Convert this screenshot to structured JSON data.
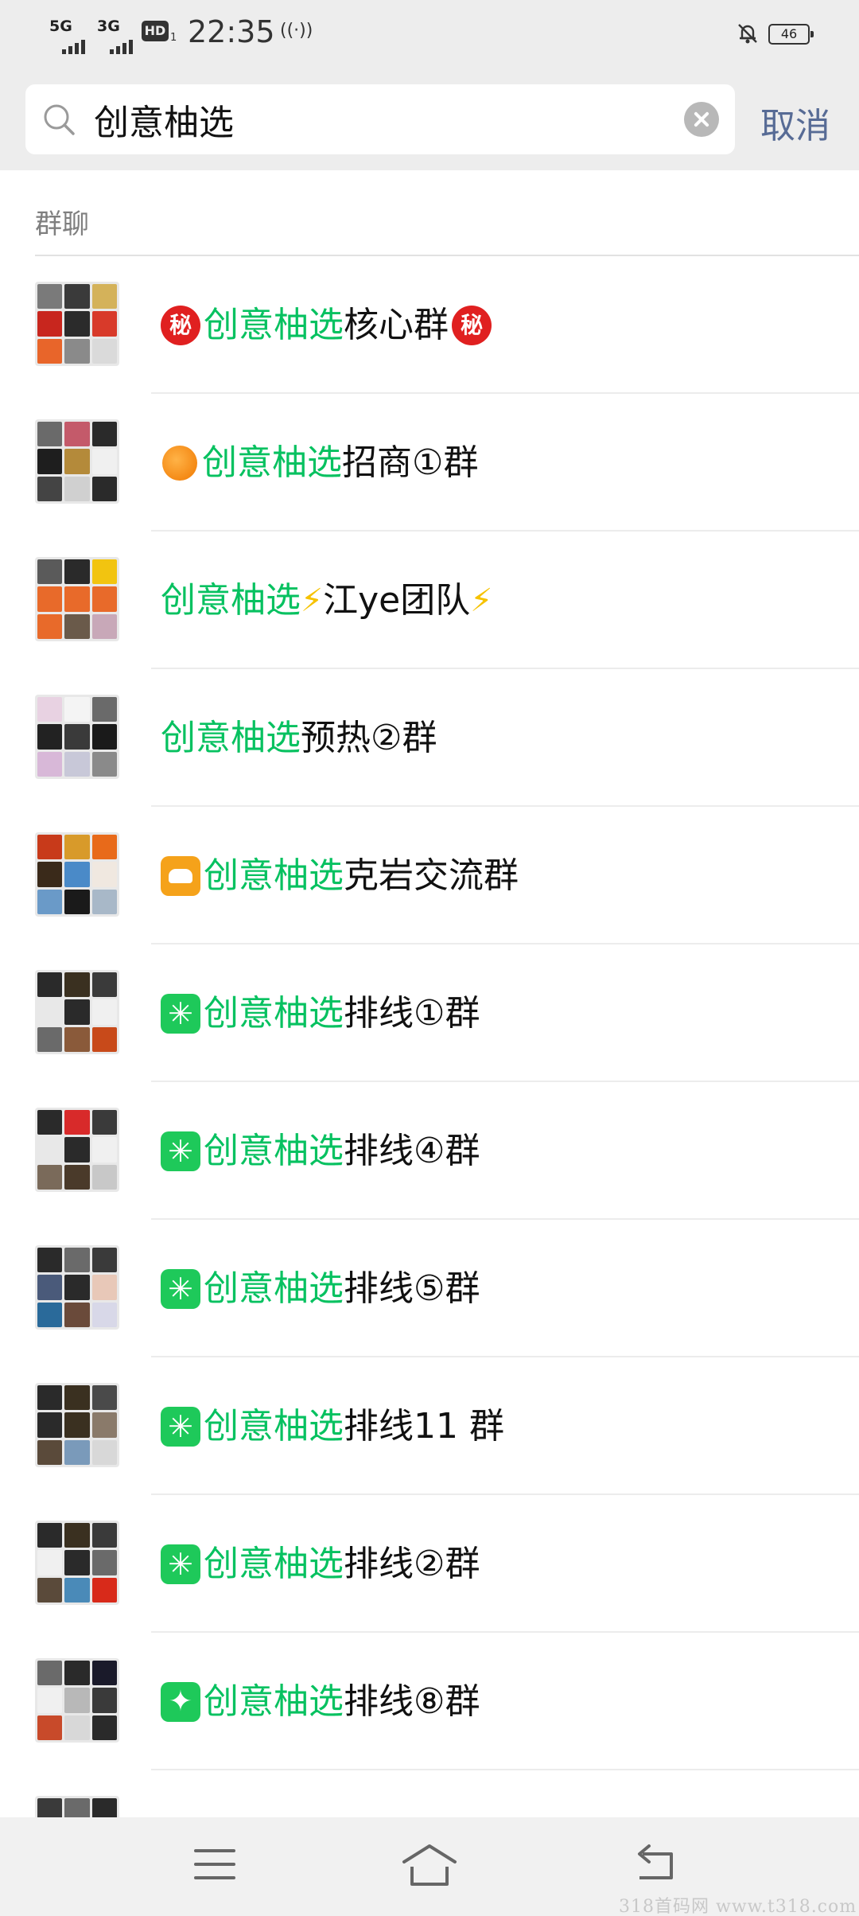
{
  "status_bar": {
    "network1": "5G",
    "network2": "3G",
    "hd": "HD",
    "hd_sub": "1",
    "time": "22:35",
    "hotspot": "((·))",
    "battery": "46"
  },
  "search": {
    "query": "创意柚选",
    "cancel_label": "取消"
  },
  "section": {
    "label": "群聊"
  },
  "results": [
    {
      "prefix": "",
      "highlight": "创意柚选",
      "rest": "核心群",
      "suffix": "",
      "icon": "secret-icon"
    },
    {
      "prefix": "",
      "highlight": "创意柚选",
      "rest": "招商①群",
      "suffix": "",
      "icon": "orange-icon"
    },
    {
      "prefix": "",
      "highlight": "创意柚选",
      "rest": "江ye团队",
      "suffix": "",
      "icon": "lightning-icon"
    },
    {
      "prefix": "",
      "highlight": "创意柚选",
      "rest": "预热②群",
      "suffix": "",
      "icon": ""
    },
    {
      "prefix": "",
      "highlight": "创意柚选",
      "rest": "克岩交流群",
      "suffix": "",
      "icon": "cat-icon"
    },
    {
      "prefix": "",
      "highlight": "创意柚选",
      "rest": "排线①群",
      "suffix": "",
      "icon": "sparkle-icon"
    },
    {
      "prefix": "",
      "highlight": " 创意柚选",
      "rest": "排线④群",
      "suffix": "",
      "icon": "sparkle-icon"
    },
    {
      "prefix": "",
      "highlight": "创意柚选",
      "rest": "排线⑤群",
      "suffix": "",
      "icon": "sparkle-icon"
    },
    {
      "prefix": "",
      "highlight": " 创意柚选",
      "rest": "排线11 群",
      "suffix": "",
      "icon": "sparkle-icon"
    },
    {
      "prefix": "",
      "highlight": "创意柚选",
      "rest": "排线②群",
      "suffix": "",
      "icon": "sparkle-icon"
    },
    {
      "prefix": "",
      "highlight": "创意柚选",
      "rest": "排线⑧群",
      "suffix": "",
      "icon": "star4-icon"
    },
    {
      "prefix": "",
      "highlight": "",
      "rest": "",
      "suffix": "",
      "icon": ""
    }
  ],
  "secret_glyph": "秘",
  "lightning_glyph": "⚡",
  "nav": {
    "menu_icon": "menu-icon",
    "home_icon": "home-icon",
    "back_icon": "back-icon"
  },
  "watermark": "318首码网 www.t318.com"
}
